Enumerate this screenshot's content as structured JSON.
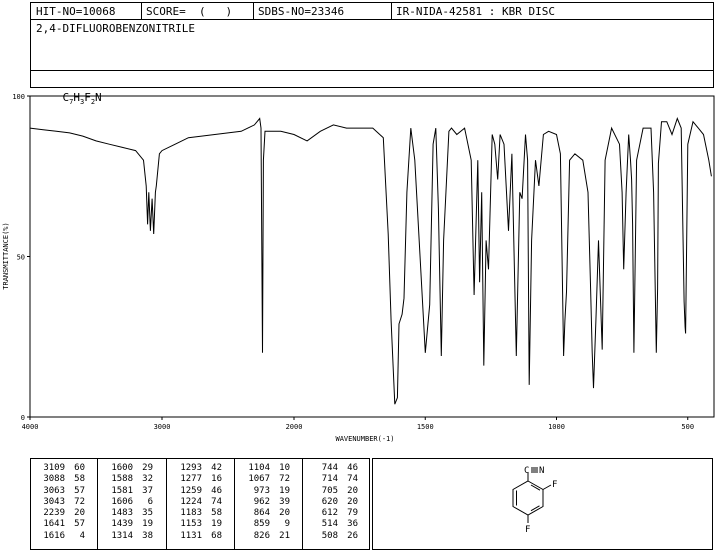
{
  "header": {
    "hit_no": "HIT-NO=10068",
    "score": "SCORE=  (   )",
    "sdbs_no": "SDBS-NO=23346",
    "ir_nida": "IR-NIDA-42581 : KBR DISC",
    "compound_name": "2,4-DIFLUOROBENZONITRILE",
    "formula_parts": [
      "C",
      "7",
      "H",
      "3",
      "F",
      "2",
      "N"
    ]
  },
  "chart_data": {
    "type": "line",
    "xlabel": "WAVENUMBER(-1)",
    "ylabel": "TRANSMITTANCE(%)",
    "xlim": [
      4000,
      400
    ],
    "ylim": [
      0,
      100
    ],
    "x_ticks": [
      4000,
      3000,
      2000,
      1500,
      1000,
      500
    ],
    "y_ticks": [
      0,
      50,
      100
    ],
    "points": [
      [
        4000,
        90
      ],
      [
        3900,
        89.5
      ],
      [
        3800,
        89
      ],
      [
        3700,
        88.5
      ],
      [
        3600,
        87.5
      ],
      [
        3500,
        86
      ],
      [
        3400,
        85
      ],
      [
        3300,
        84
      ],
      [
        3200,
        83
      ],
      [
        3140,
        80
      ],
      [
        3120,
        72
      ],
      [
        3109,
        60
      ],
      [
        3100,
        70
      ],
      [
        3088,
        58
      ],
      [
        3075,
        68
      ],
      [
        3063,
        57
      ],
      [
        3050,
        70
      ],
      [
        3043,
        72
      ],
      [
        3020,
        82
      ],
      [
        3000,
        83
      ],
      [
        2900,
        85
      ],
      [
        2800,
        87
      ],
      [
        2700,
        87.5
      ],
      [
        2600,
        88
      ],
      [
        2500,
        88.5
      ],
      [
        2400,
        89
      ],
      [
        2300,
        91
      ],
      [
        2260,
        93
      ],
      [
        2250,
        90
      ],
      [
        2239,
        20
      ],
      [
        2232,
        80
      ],
      [
        2220,
        89
      ],
      [
        2100,
        89
      ],
      [
        2000,
        88
      ],
      [
        1950,
        86
      ],
      [
        1900,
        89
      ],
      [
        1850,
        91
      ],
      [
        1800,
        90
      ],
      [
        1750,
        90
      ],
      [
        1700,
        90
      ],
      [
        1660,
        87
      ],
      [
        1641,
        57
      ],
      [
        1630,
        30
      ],
      [
        1616,
        4
      ],
      [
        1606,
        6
      ],
      [
        1600,
        29
      ],
      [
        1588,
        32
      ],
      [
        1581,
        37
      ],
      [
        1570,
        70
      ],
      [
        1555,
        90
      ],
      [
        1540,
        80
      ],
      [
        1500,
        20
      ],
      [
        1483,
        35
      ],
      [
        1470,
        85
      ],
      [
        1460,
        90
      ],
      [
        1450,
        65
      ],
      [
        1439,
        19
      ],
      [
        1430,
        55
      ],
      [
        1410,
        89
      ],
      [
        1400,
        90
      ],
      [
        1380,
        88
      ],
      [
        1350,
        90
      ],
      [
        1325,
        80
      ],
      [
        1314,
        38
      ],
      [
        1300,
        80
      ],
      [
        1293,
        42
      ],
      [
        1285,
        70
      ],
      [
        1277,
        16
      ],
      [
        1268,
        55
      ],
      [
        1259,
        46
      ],
      [
        1245,
        88
      ],
      [
        1235,
        85
      ],
      [
        1224,
        74
      ],
      [
        1215,
        88
      ],
      [
        1200,
        85
      ],
      [
        1183,
        58
      ],
      [
        1170,
        82
      ],
      [
        1153,
        19
      ],
      [
        1140,
        70
      ],
      [
        1131,
        68
      ],
      [
        1118,
        88
      ],
      [
        1110,
        80
      ],
      [
        1104,
        10
      ],
      [
        1095,
        55
      ],
      [
        1080,
        80
      ],
      [
        1067,
        72
      ],
      [
        1050,
        88
      ],
      [
        1030,
        89
      ],
      [
        1000,
        88
      ],
      [
        985,
        82
      ],
      [
        973,
        19
      ],
      [
        968,
        30
      ],
      [
        962,
        39
      ],
      [
        950,
        80
      ],
      [
        930,
        82
      ],
      [
        900,
        80
      ],
      [
        880,
        70
      ],
      [
        870,
        40
      ],
      [
        864,
        20
      ],
      [
        859,
        9
      ],
      [
        850,
        30
      ],
      [
        840,
        55
      ],
      [
        826,
        21
      ],
      [
        815,
        80
      ],
      [
        790,
        90
      ],
      [
        760,
        85
      ],
      [
        750,
        70
      ],
      [
        744,
        46
      ],
      [
        735,
        70
      ],
      [
        725,
        88
      ],
      [
        718,
        80
      ],
      [
        714,
        74
      ],
      [
        710,
        60
      ],
      [
        705,
        20
      ],
      [
        695,
        80
      ],
      [
        670,
        90
      ],
      [
        640,
        90
      ],
      [
        630,
        70
      ],
      [
        620,
        20
      ],
      [
        615,
        40
      ],
      [
        612,
        79
      ],
      [
        600,
        92
      ],
      [
        580,
        92
      ],
      [
        560,
        88
      ],
      [
        540,
        93
      ],
      [
        525,
        90
      ],
      [
        514,
        36
      ],
      [
        510,
        28
      ],
      [
        508,
        26
      ],
      [
        500,
        85
      ],
      [
        480,
        92
      ],
      [
        460,
        90
      ],
      [
        440,
        88
      ],
      [
        420,
        80
      ],
      [
        410,
        75
      ]
    ],
    "peak_table": {
      "columns": [
        {
          "wavenumber": [
            "3109",
            "3088",
            "3063",
            "3043",
            "2239",
            "1641",
            "1616"
          ],
          "transmittance": [
            "60",
            "58",
            "57",
            "72",
            "20",
            "57",
            "4"
          ]
        },
        {
          "wavenumber": [
            "1600",
            "1588",
            "1581",
            "1606",
            "1483",
            "1439",
            "1314"
          ],
          "transmittance": [
            "29",
            "32",
            "37",
            "6",
            "35",
            "19",
            "38"
          ]
        },
        {
          "wavenumber": [
            "1293",
            "1277",
            "1259",
            "1224",
            "1183",
            "1153",
            "1131"
          ],
          "transmittance": [
            "42",
            "16",
            "46",
            "74",
            "58",
            "19",
            "68"
          ]
        },
        {
          "wavenumber": [
            "1104",
            "1067",
            "973",
            "962",
            "864",
            "859",
            "826"
          ],
          "transmittance": [
            "10",
            "72",
            "19",
            "39",
            "20",
            "9",
            "21"
          ]
        },
        {
          "wavenumber": [
            "744",
            "714",
            "705",
            "620",
            "612",
            "514",
            "508"
          ],
          "transmittance": [
            "46",
            "74",
            "20",
            "20",
            "79",
            "36",
            "26"
          ]
        }
      ]
    }
  },
  "structure": {
    "atom_labels": [
      "C",
      "N",
      "F",
      "F"
    ]
  }
}
